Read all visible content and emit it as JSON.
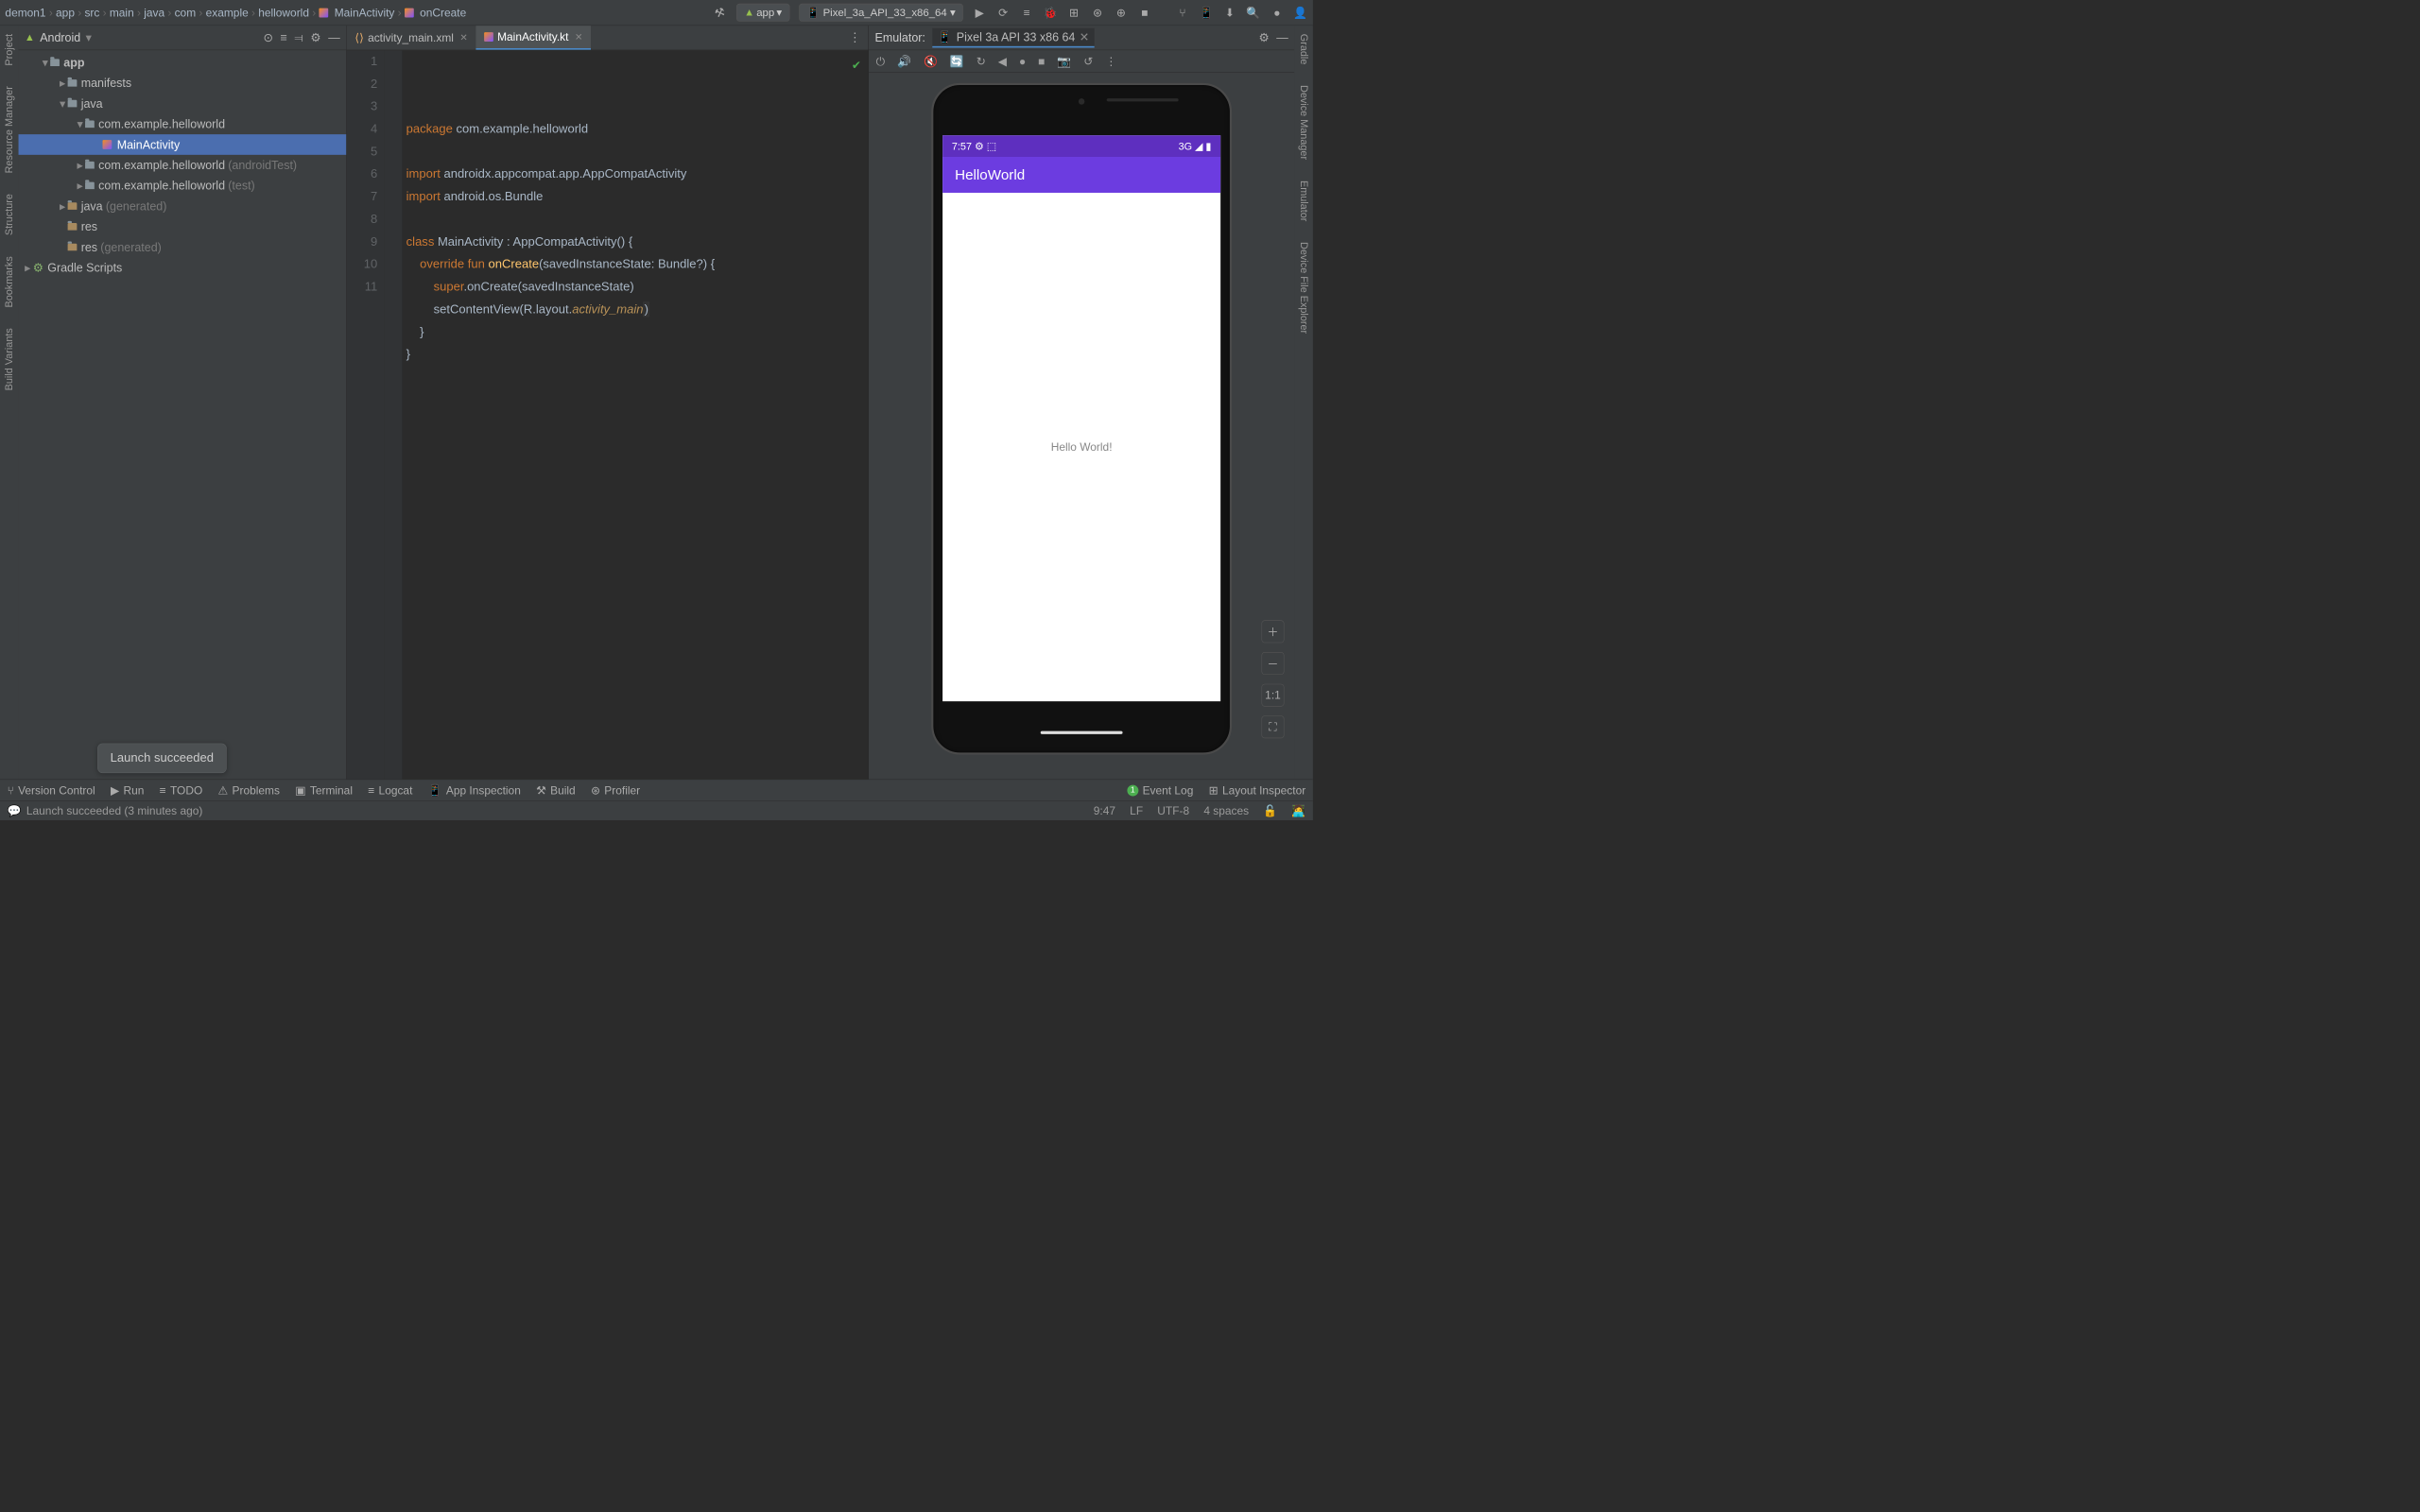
{
  "breadcrumbs": [
    "demon1",
    "app",
    "src",
    "main",
    "java",
    "com",
    "example",
    "helloworld",
    "MainActivity",
    "onCreate"
  ],
  "runConfig": "app",
  "deviceSelect": "Pixel_3a_API_33_x86_64",
  "leftStrip": [
    "Project",
    "Resource Manager",
    "Structure",
    "Bookmarks",
    "Build Variants"
  ],
  "rightStrip": [
    "Gradle",
    "Device Manager",
    "Emulator",
    "Device File Explorer"
  ],
  "projectPanel": {
    "title": "Android"
  },
  "tree": {
    "root": "app",
    "nodes": [
      {
        "indent": 1,
        "arrow": "▾",
        "label": "app",
        "bold": true
      },
      {
        "indent": 2,
        "arrow": "▸",
        "label": "manifests"
      },
      {
        "indent": 2,
        "arrow": "▾",
        "label": "java"
      },
      {
        "indent": 3,
        "arrow": "▾",
        "label": "com.example.helloworld"
      },
      {
        "indent": 4,
        "arrow": "",
        "label": "MainActivity",
        "selected": true,
        "fileIcon": true
      },
      {
        "indent": 3,
        "arrow": "▸",
        "label": "com.example.helloworld",
        "suffix": "(androidTest)"
      },
      {
        "indent": 3,
        "arrow": "▸",
        "label": "com.example.helloworld",
        "suffix": "(test)"
      },
      {
        "indent": 2,
        "arrow": "▸",
        "label": "java",
        "suffix": "(generated)",
        "genIcon": true
      },
      {
        "indent": 2,
        "arrow": "",
        "label": "res",
        "resIcon": true
      },
      {
        "indent": 2,
        "arrow": "",
        "label": "res",
        "suffix": "(generated)",
        "resIcon": true
      }
    ],
    "scripts": "Gradle Scripts"
  },
  "editorTabs": [
    {
      "label": "activity_main.xml",
      "active": false,
      "icon": "xml"
    },
    {
      "label": "MainActivity.kt",
      "active": true,
      "icon": "kotlin"
    }
  ],
  "code": {
    "lines": [
      [
        {
          "t": "package ",
          "c": "kw"
        },
        {
          "t": "com.example.helloworld"
        }
      ],
      [],
      [
        {
          "t": "import ",
          "c": "kw"
        },
        {
          "t": "androidx.appcompat.app.AppCompatActivity"
        }
      ],
      [
        {
          "t": "import ",
          "c": "kw"
        },
        {
          "t": "android.os.Bundle"
        }
      ],
      [],
      [
        {
          "t": "class ",
          "c": "kw"
        },
        {
          "t": "MainActivity : AppCompatActivity() {"
        }
      ],
      [
        {
          "t": "    "
        },
        {
          "t": "override fun ",
          "c": "kw"
        },
        {
          "t": "onCreate",
          "c": "fn"
        },
        {
          "t": "(savedInstanceState: Bundle?) {"
        }
      ],
      [
        {
          "t": "        "
        },
        {
          "t": "super",
          "c": "kw"
        },
        {
          "t": ".onCreate(savedInstanceState)"
        }
      ],
      [
        {
          "t": "        setContentView(R.layout."
        },
        {
          "t": "activity_main",
          "c": "it"
        },
        {
          "t": ")",
          "hl": true
        }
      ],
      [
        {
          "t": "    }"
        }
      ],
      [
        {
          "t": "}"
        }
      ]
    ]
  },
  "emulator": {
    "label": "Emulator:",
    "tab": "Pixel 3a API 33 x86 64",
    "toolbar": [
      "⏻",
      "🔊",
      "🔇",
      "🔄",
      "↻",
      "◀",
      "●",
      "■",
      "📷",
      "↺",
      "⋮"
    ],
    "statusLeft": "7:57 ⚙ ⬚",
    "statusRight": "3G ◢ ▮",
    "appTitle": "HelloWorld",
    "contentText": "Hello World!",
    "zoomButtons": [
      "＋",
      "－",
      "1:1",
      "⛶"
    ]
  },
  "bottomBar": {
    "items": [
      "Version Control",
      "Run",
      "TODO",
      "Problems",
      "Terminal",
      "Logcat",
      "App Inspection",
      "Build",
      "Profiler"
    ],
    "eventLog": "Event Log",
    "layoutInspector": "Layout Inspector"
  },
  "toast": "Launch succeeded",
  "statusBar": {
    "message": "Launch succeeded (3 minutes ago)",
    "right": [
      "9:47",
      "LF",
      "UTF-8",
      "4 spaces",
      "🔓",
      "🧑‍💻"
    ]
  }
}
